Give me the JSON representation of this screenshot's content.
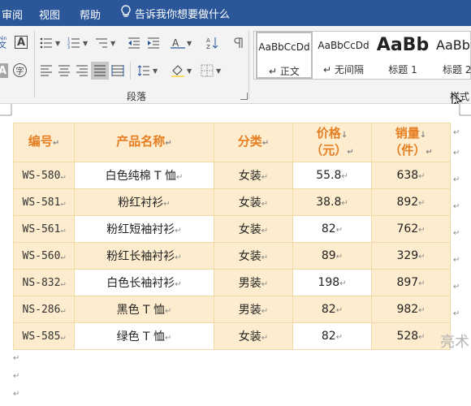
{
  "menubar": {
    "tabs": [
      "审阅",
      "视图",
      "帮助"
    ],
    "tell_me": "告诉我你想要做什么"
  },
  "ribbon": {
    "paragraph_group": "段落",
    "styles_group": "样式",
    "styles": [
      {
        "preview": "AaBbCcDd",
        "mark": "↵ ",
        "name": "正文"
      },
      {
        "preview": "AaBbCcDd",
        "mark": "↵ ",
        "name": "无间隔"
      },
      {
        "preview": "AaBb",
        "mark": "",
        "name": "标题 1"
      },
      {
        "preview": "AaBb",
        "mark": "",
        "name": "标题 2"
      }
    ]
  },
  "table": {
    "headers": [
      "编号",
      "产品名称",
      "分类",
      {
        "line1": "价格",
        "line2": "（元）"
      },
      {
        "line1": "销量",
        "line2": "（件）"
      }
    ],
    "rows": [
      {
        "code": "WS-580",
        "name": "白色纯棉 T 恤",
        "category": "女装",
        "price": "55.8",
        "sales": "638"
      },
      {
        "code": "WS-581",
        "name": "粉红衬衫",
        "category": "女装",
        "price": "38.8",
        "sales": "892"
      },
      {
        "code": "WS-561",
        "name": "粉红短袖衬衫",
        "category": "女装",
        "price": "82",
        "sales": "762"
      },
      {
        "code": "WS-560",
        "name": "粉红长袖衬衫",
        "category": "女装",
        "price": "89",
        "sales": "329"
      },
      {
        "code": "NS-832",
        "name": "白色长袖衬衫",
        "category": "男装",
        "price": "198",
        "sales": "897"
      },
      {
        "code": "NS-286",
        "name": "黑色 T 恤",
        "category": "男装",
        "price": "82",
        "sales": "982"
      },
      {
        "code": "WS-585",
        "name": "绿色 T 恤",
        "category": "女装",
        "price": "82",
        "sales": "528"
      }
    ]
  },
  "document": {
    "watermark": "亮术"
  },
  "colors": {
    "title_bar": "#2b579a",
    "header_text": "#e67e22",
    "cell_fill": "#fdeccd",
    "cell_border": "#f2d9a8"
  }
}
